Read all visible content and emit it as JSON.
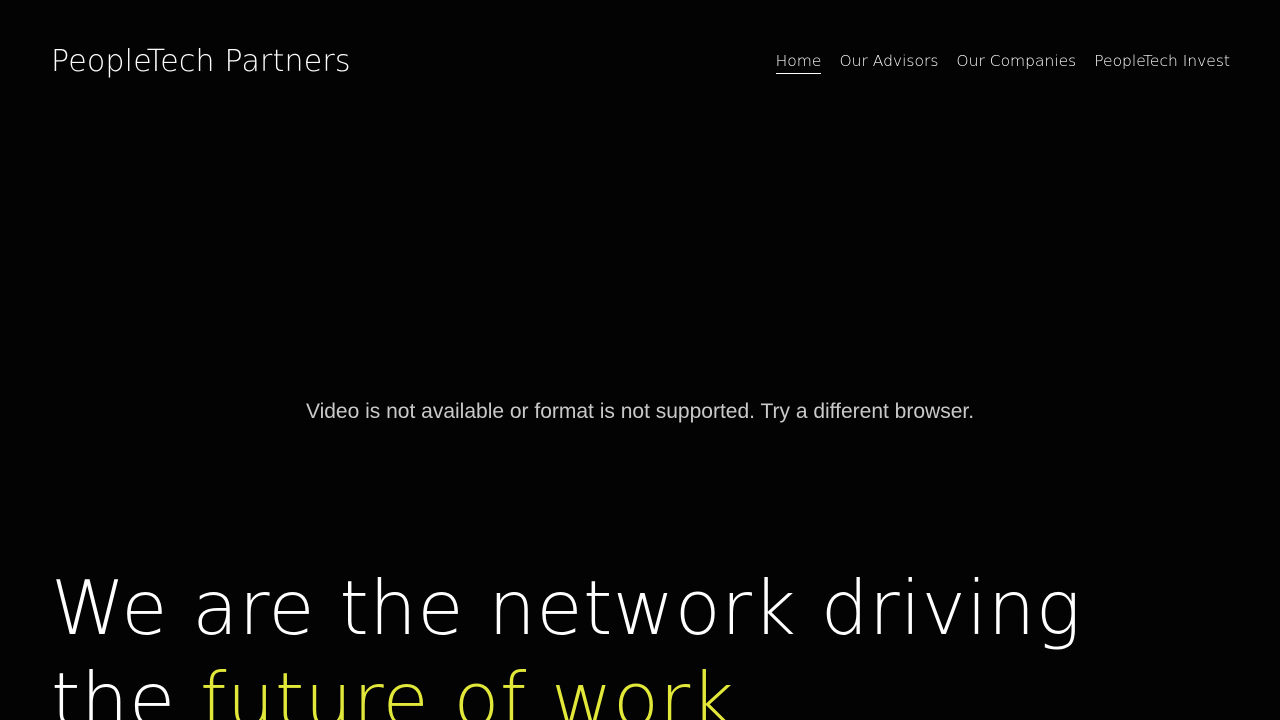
{
  "header": {
    "site_title": "PeopleTech Partners",
    "nav": [
      {
        "label": "Home",
        "active": true
      },
      {
        "label": "Our Advisors",
        "active": false
      },
      {
        "label": "Our Companies",
        "active": false
      },
      {
        "label": "PeopleTech Invest",
        "active": false
      }
    ]
  },
  "video": {
    "message": "Video is not available or format is not supported. Try a different browser."
  },
  "hero": {
    "line1": "We are the network driving",
    "line2_prefix": "the ",
    "line2_accent": "future of work"
  },
  "colors": {
    "background": "#030303",
    "text": "#ffffff",
    "muted_text": "#c9c9c9",
    "accent": "#e2e83a"
  }
}
